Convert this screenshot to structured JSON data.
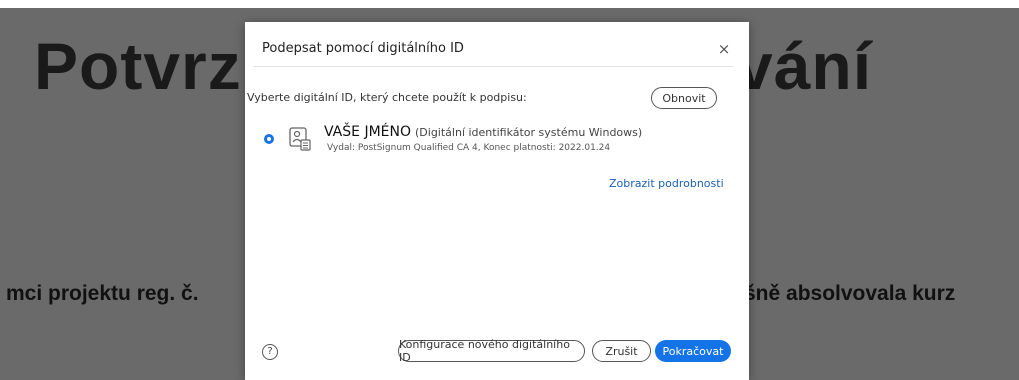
{
  "background": {
    "title_left": "Potvrz",
    "title_right": "vání",
    "line_left": "mci projektu reg. č.",
    "line_right": "šně absolvovala kurz"
  },
  "dialog": {
    "title": "Podepsat pomocí digitálního ID",
    "close_glyph": "×",
    "prompt": "Vyberte digitální ID, který chcete použít k podpisu:",
    "refresh_label": "Obnovit",
    "identity": {
      "name": "VAŠE JMÉNO",
      "description": "(Digitální identifikátor systému Windows)",
      "issuer": "Vydal: PostSignum Qualified CA 4, Konec platnosti: 2022.01.24",
      "selected": true
    },
    "details_link": "Zobrazit podrobnosti",
    "help_glyph": "?",
    "configure_label": "Konfigurace nového digitálního ID",
    "cancel_label": "Zrušit",
    "continue_label": "Pokračovat"
  },
  "colors": {
    "accent": "#1473e6",
    "backdrop": "#6a6a6a",
    "link": "#1a5fb4"
  }
}
